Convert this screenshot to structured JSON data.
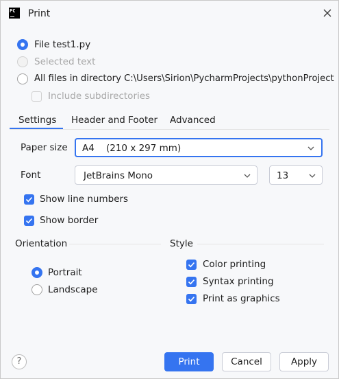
{
  "window": {
    "title": "Print",
    "app_icon_label": "PC"
  },
  "scope": {
    "file_option": "File test1.py",
    "selected_text_option": "Selected text",
    "all_files_option": "All files in directory C:\\Users\\Sirion\\PycharmProjects\\pythonProject",
    "include_subdirectories": "Include subdirectories",
    "selected": "file"
  },
  "tabs": [
    {
      "label": "Settings",
      "active": true
    },
    {
      "label": "Header and Footer",
      "active": false
    },
    {
      "label": "Advanced",
      "active": false
    }
  ],
  "settings": {
    "paper_size_label": "Paper size",
    "paper_size_value": "A4    (210 x 297 mm)",
    "font_label": "Font",
    "font_value": "JetBrains Mono",
    "font_size_value": "13",
    "show_line_numbers": {
      "label": "Show line numbers",
      "checked": true
    },
    "show_border": {
      "label": "Show border",
      "checked": true
    }
  },
  "orientation": {
    "title": "Orientation",
    "portrait": "Portrait",
    "landscape": "Landscape",
    "selected": "portrait"
  },
  "style": {
    "title": "Style",
    "color_printing": {
      "label": "Color printing",
      "checked": true
    },
    "syntax_printing": {
      "label": "Syntax printing",
      "checked": true
    },
    "print_as_graphics": {
      "label": "Print as graphics",
      "checked": true
    }
  },
  "footer": {
    "help_label": "?",
    "print_label": "Print",
    "cancel_label": "Cancel",
    "apply_label": "Apply"
  },
  "colors": {
    "accent": "#3574f0",
    "background": "#f7f8fa",
    "text": "#1e1e1e",
    "disabled_text": "#a8a8a8"
  }
}
